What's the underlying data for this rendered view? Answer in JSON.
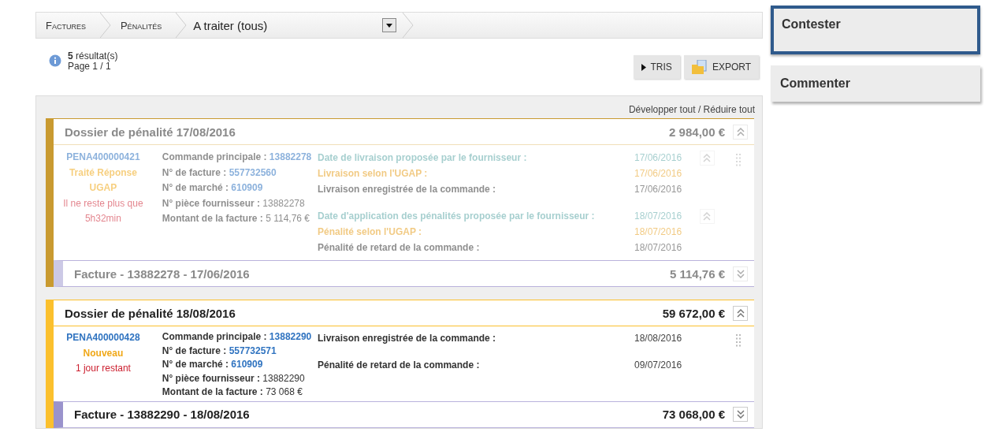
{
  "breadcrumb": {
    "items": [
      "Factures",
      "Pénalités"
    ],
    "current": "A traiter (tous)"
  },
  "results": {
    "count": "5",
    "count_label": "résultat(s)",
    "page": "Page 1 / 1"
  },
  "toolbar": [
    "TRIS",
    "EXPORT"
  ],
  "expand_collapse": "Développer tout / Réduire tout",
  "dossiers": [
    {
      "title": "Dossier de pénalité 17/08/2016",
      "amount": "2 984,00 €",
      "expanded": true,
      "dimmed": true,
      "color": "#c99a30",
      "id": "PENA400000421",
      "status": "Traité Réponse UGAP",
      "remaining": [
        "Il ne reste plus que",
        "5h32min"
      ],
      "fields": [
        {
          "label": "Commande principale :",
          "value": "13882278",
          "kind": "link"
        },
        {
          "label": "N° de facture :",
          "value": "557732560",
          "kind": "link"
        },
        {
          "label": "N° de marché :",
          "value": "610909",
          "kind": "link"
        },
        {
          "label": "N° pièce fournisseur :",
          "value": "13882278",
          "kind": "plain"
        },
        {
          "label": "Montant de la facture :",
          "value": "5 114,76 €",
          "kind": "plain"
        }
      ],
      "date_groups": [
        {
          "collapsible": true,
          "rows": [
            {
              "kind": "proposed",
              "label": "Date de livraison proposée par le fournisseur :",
              "value": "17/06/2016"
            },
            {
              "kind": "ugap",
              "label": "Livraison selon l'UGAP :",
              "value": "17/06/2016"
            },
            {
              "kind": "recorded",
              "label": "Livraison enregistrée de la commande :",
              "value": "17/06/2016"
            }
          ]
        },
        {
          "collapsible": true,
          "rows": [
            {
              "kind": "proposed",
              "label": "Date d'application des pénalités proposée par le fournisseur :",
              "value": "18/07/2016"
            },
            {
              "kind": "ugap",
              "label": "Pénalité selon l'UGAP :",
              "value": "18/07/2016"
            },
            {
              "kind": "recorded",
              "label": "Pénalité de retard de la commande :",
              "value": "18/07/2016"
            }
          ]
        }
      ],
      "facture": {
        "title": "Facture - 13882278 - 17/06/2016",
        "amount": "5 114,76 €",
        "expanded": false
      }
    },
    {
      "title": "Dossier de pénalité 18/08/2016",
      "amount": "59 672,00 €",
      "expanded": true,
      "dimmed": false,
      "color": "#fbc02d",
      "id": "PENA400000428",
      "status": "Nouveau",
      "remaining": [
        "1 jour restant"
      ],
      "fields": [
        {
          "label": "Commande principale :",
          "value": "13882290",
          "kind": "link"
        },
        {
          "label": "N° de facture :",
          "value": "557732571",
          "kind": "link"
        },
        {
          "label": "N° de marché :",
          "value": "610909",
          "kind": "link"
        },
        {
          "label": "N° pièce fournisseur :",
          "value": "13882290",
          "kind": "plain"
        },
        {
          "label": "Montant de la facture :",
          "value": "73 068 €",
          "kind": "plain"
        }
      ],
      "date_groups": [
        {
          "collapsible": false,
          "rows": [
            {
              "kind": "recorded",
              "label": "Livraison enregistrée de la commande :",
              "value": "18/08/2016"
            }
          ]
        },
        {
          "collapsible": false,
          "rows": [
            {
              "kind": "recorded",
              "label": "Pénalité de retard de la commande :",
              "value": "09/07/2016"
            }
          ]
        }
      ],
      "facture": {
        "title": "Facture - 13882290 - 18/08/2016",
        "amount": "73 068,00 €",
        "expanded": false
      }
    }
  ],
  "actions": [
    {
      "label": "Contester",
      "selected": true
    },
    {
      "label": "Commenter",
      "selected": false
    }
  ]
}
